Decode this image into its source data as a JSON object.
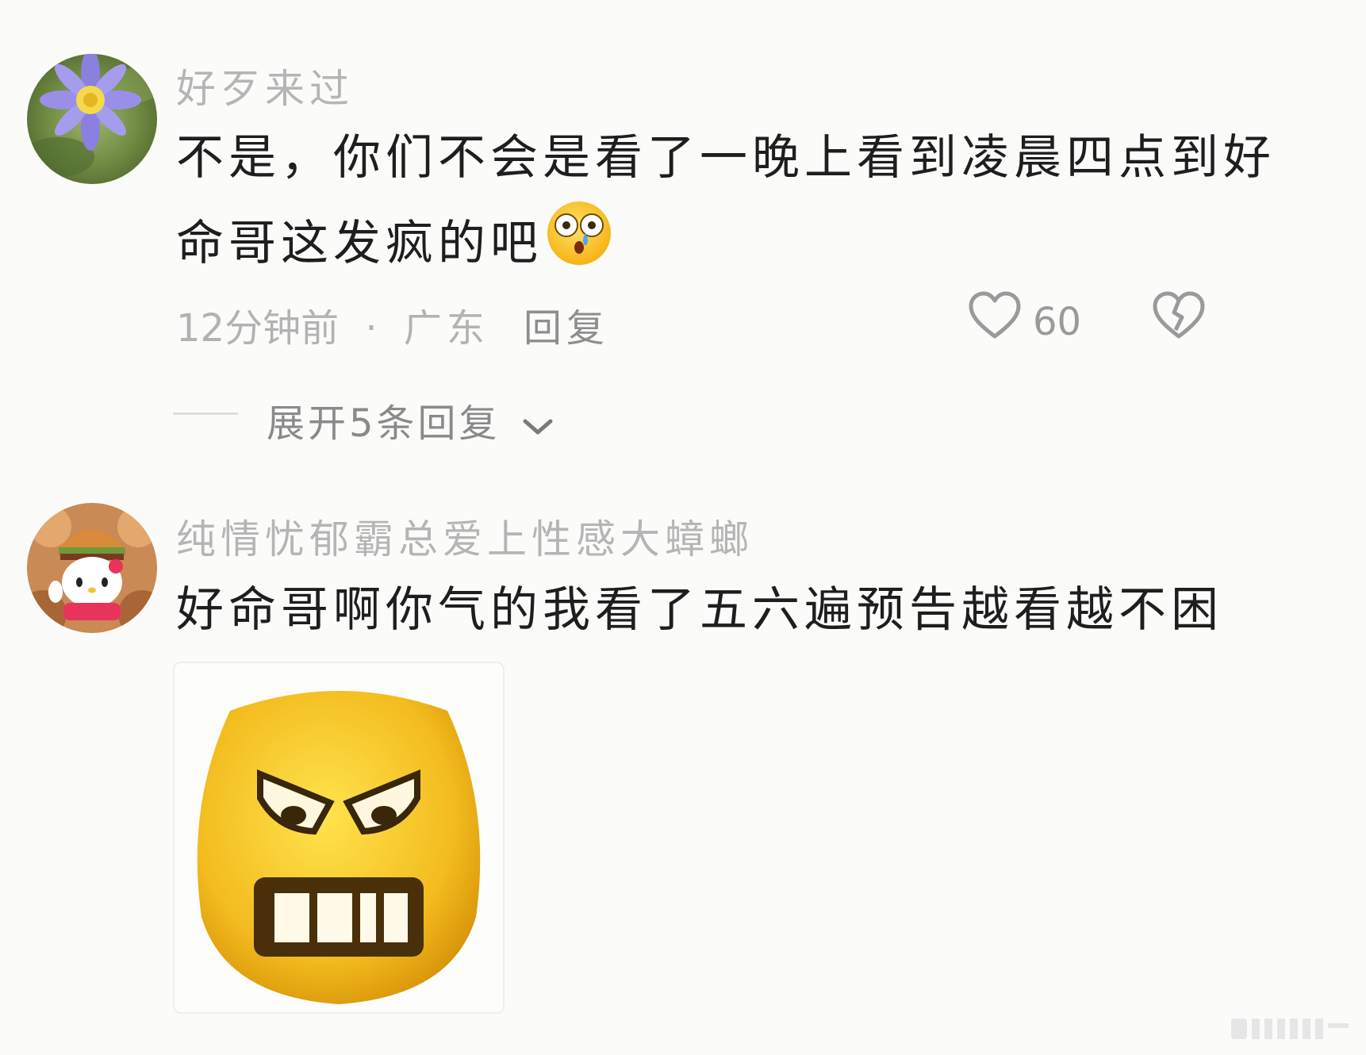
{
  "comments": [
    {
      "username": "好歹来过",
      "text": "不是，你们不会是看了一晚上看到凌晨四点到好命哥这发疯的吧",
      "emoji": "flushed-face-emoji",
      "time": "12分钟前",
      "location": "广东",
      "separator": "·",
      "reply_label": "回复",
      "likes": "60",
      "expand_label": "展开5条回复"
    },
    {
      "username": "纯情忧郁霸总爱上性感大蟑螂",
      "text": "好命哥啊你气的我看了五六遍预告越看越不困",
      "sticker": "angry-face-sticker"
    }
  ],
  "icons": {
    "like": "heart-outline-icon",
    "dislike": "broken-heart-icon",
    "expand": "chevron-down-icon"
  },
  "colors": {
    "background": "#fbfbf9",
    "username": "#b5b5b5",
    "text": "#1e1e1e",
    "meta": "#b2b2b2"
  }
}
